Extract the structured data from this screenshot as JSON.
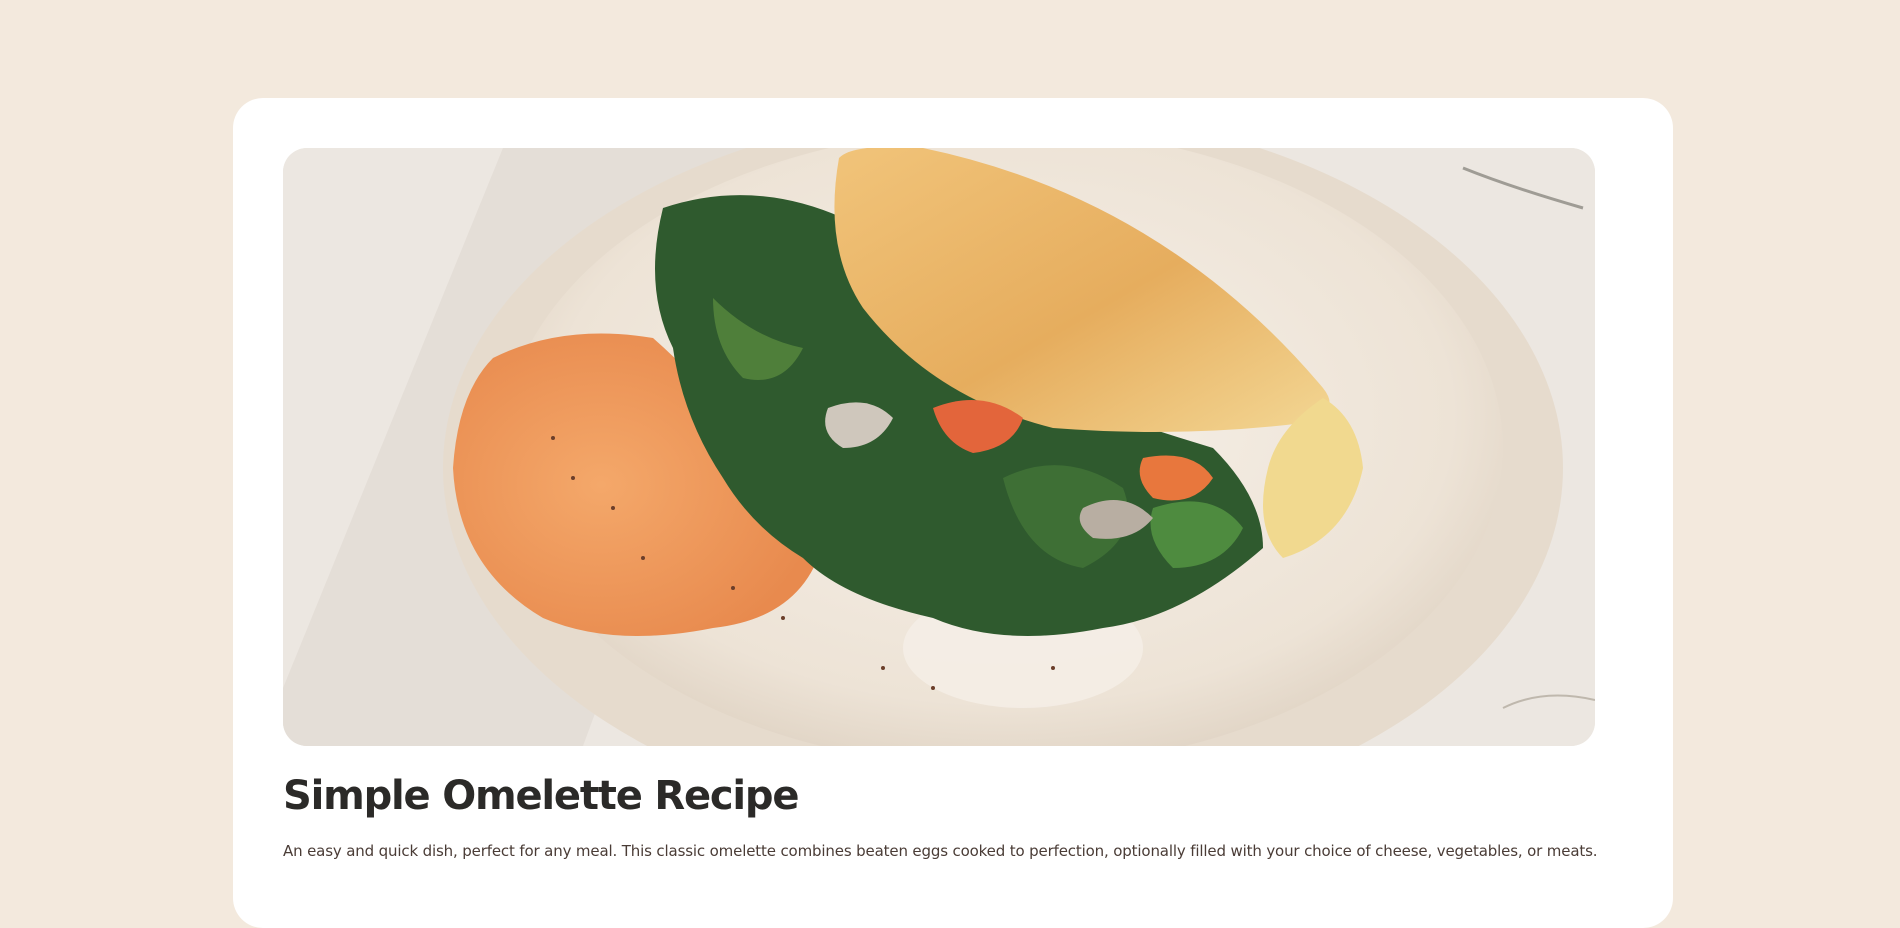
{
  "recipe": {
    "image_alt": "omelette-with-spinach-and-hummus-photo",
    "title": "Simple Omelette Recipe",
    "description": "An easy and quick dish, perfect for any meal. This classic omelette combines beaten eggs cooked to perfection, optionally filled with your choice of cheese, vegetables, or meats."
  },
  "colors": {
    "page_background": "#f3e9dd",
    "card_background": "#ffffff",
    "title_text": "#2b2a28",
    "body_text": "#4a3c36"
  }
}
